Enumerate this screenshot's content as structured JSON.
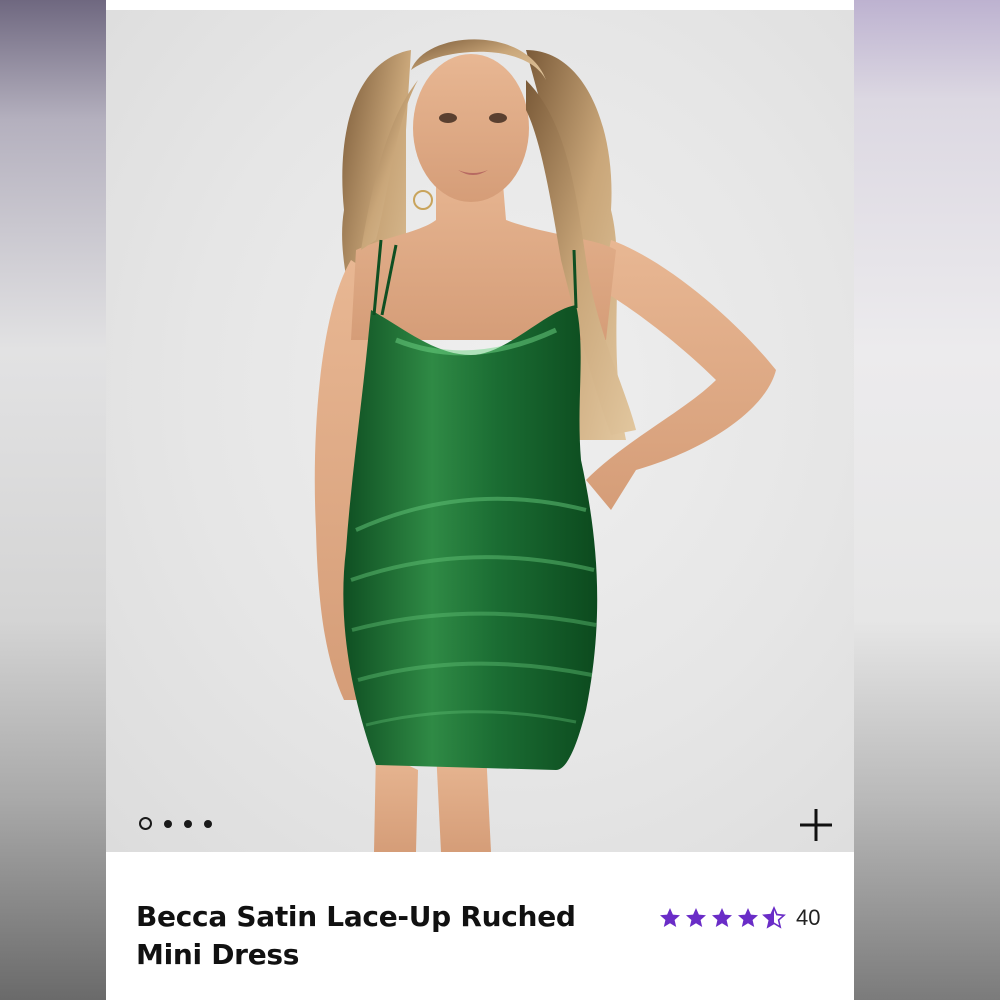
{
  "colors": {
    "star": "#6a2cc7",
    "dress": "#1e6b32",
    "text": "#111111"
  },
  "carousel": {
    "total_slides": 4,
    "active_index": 0
  },
  "product": {
    "title_line1": "Becca Satin Lace-Up Ruched",
    "title_line2": "Mini Dress",
    "rating_value": 4.5,
    "rating_max": 5,
    "review_count": "40"
  },
  "icons": {
    "zoom": "plus-icon",
    "star_full": "star-icon",
    "star_half": "half-star-icon"
  }
}
